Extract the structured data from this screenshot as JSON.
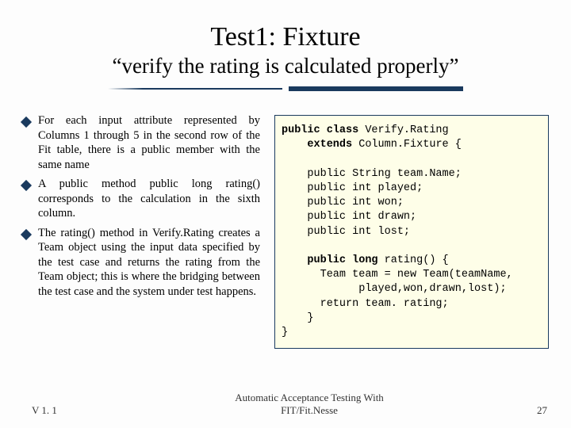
{
  "title": "Test1: Fixture",
  "subtitle": "“verify the rating is calculated properly”",
  "bullets": [
    "For each input attribute represented by Columns 1 through 5 in the second row of the Fit table, there is a public member with the same name",
    "A public method public long rating() corresponds to the calculation in the sixth column.",
    "The rating() method in Verify.Rating creates a Team object using the input data specified by the test case and returns the rating from the Team object; this is where the bridging between the test case and the system under test happens."
  ],
  "code": {
    "l1a": "public class",
    "l1b": " Verify.Rating",
    "l2a": "    extends",
    "l2b": " Column.Fixture {",
    "l3": "",
    "l4": "    public String team.Name;",
    "l5": "    public int played;",
    "l6": "    public int won;",
    "l7": "    public int drawn;",
    "l8": "    public int lost;",
    "l9": "",
    "l10a": "    public long",
    "l10b": " rating() {",
    "l11": "      Team team = new Team(teamName,",
    "l12": "            played,won,drawn,lost);",
    "l13": "      return team. rating;",
    "l14": "    }",
    "l15": "}"
  },
  "footer": {
    "version": "V 1. 1",
    "center1": "Automatic Acceptance Testing With",
    "center2": "FIT/Fit.Nesse",
    "page": "27"
  }
}
